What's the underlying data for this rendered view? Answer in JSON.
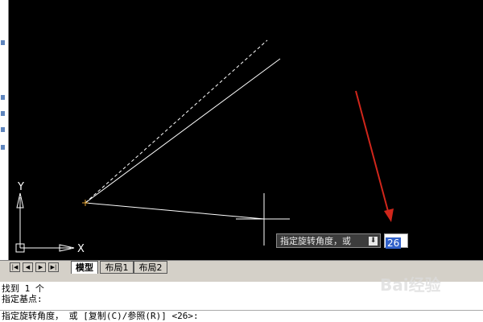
{
  "canvas": {
    "axis_y_label": "Y",
    "axis_x_label": "X"
  },
  "tooltip": {
    "prompt_label": "指定旋转角度，或",
    "dropdown_icon": "download-arrow-icon",
    "input_value": "26"
  },
  "layout_tabs": {
    "nav_buttons": [
      "|◀",
      "◀",
      "▶",
      "▶|"
    ],
    "tabs": [
      {
        "label": "模型",
        "active": true
      },
      {
        "label": "布局1",
        "active": false
      },
      {
        "label": "布局2",
        "active": false
      }
    ]
  },
  "command_window": {
    "history": [
      "找到 1 个",
      "指定基点:"
    ],
    "current_prompt": "指定旋转角度， 或 [复制(C)/参照(R)] <26>:"
  },
  "watermark": {
    "text": "Bai经验"
  },
  "colors": {
    "canvas_bg": "#000000",
    "entity_line": "#ffffff",
    "arrow": "#d0261b",
    "highlight": "#3161c9"
  }
}
